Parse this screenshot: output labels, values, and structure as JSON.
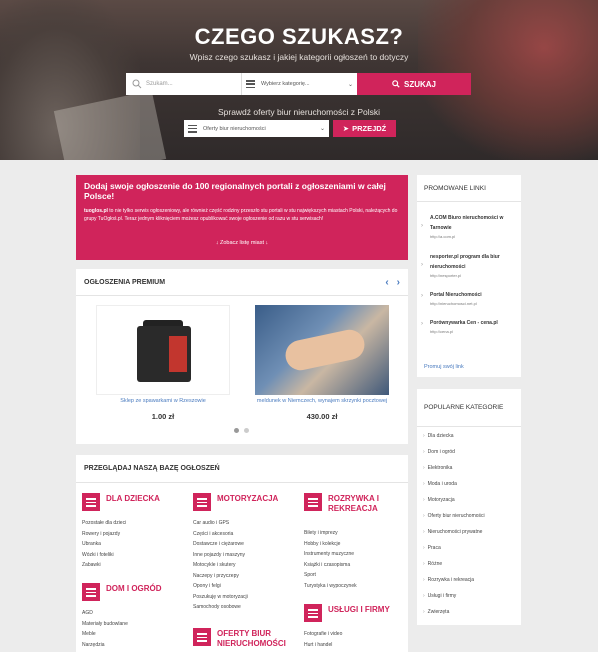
{
  "hero": {
    "title": "CZEGO SZUKASZ?",
    "subtitle": "Wpisz czego szukasz i jakiej kategorii ogłoszeń to dotyczy",
    "search_placeholder": "Szukam...",
    "category_select": "Wybierz kategorię...",
    "search_button": "SZUKAJ",
    "offices_text": "Sprawdź oferty biur nieruchomości z Polski",
    "office_select": "Oferty biur nieruchomości",
    "go_button": "PRZEJDŹ"
  },
  "banner": {
    "title": "Dodaj swoje ogłoszenie do 100 regionalnych portali z ogłoszeniami w całej Polsce!",
    "body_brand": "tuoglos.pl",
    "body": " to nie tylko serwis ogłoszeniowy, ale również część rodziny przeszło stu portali w stu największych miastach Polski, należących do grupy TuOgłoś.pl. Teraz jednym kliknięciem możesz opublikować swoje ogłoszenie od razu w stu serwisach!",
    "link": "↓ Zobacz listę miast ↓"
  },
  "premium": {
    "header": "OGŁOSZENIA PREMIUM",
    "items": [
      {
        "title": "Sklep ze spawarkami w Rzeszowie",
        "price": "1.00 zł"
      },
      {
        "title": "meldunek w Niemczech, wynajem skrzynki pocztowej",
        "price": "430.00 zł"
      }
    ]
  },
  "database": {
    "header": "PRZEGLĄDAJ NASZĄ BAZĘ OGŁOSZEŃ",
    "categories": [
      {
        "name": "DLA DZIECKA",
        "subs": [
          "Pozostałe dla dzieci",
          "Rowery i pojazdy",
          "Ubranka",
          "Wózki i foteliki",
          "Zabawki"
        ]
      },
      {
        "name": "DOM I OGRÓD",
        "subs": [
          "AGD",
          "Materiały budowlane",
          "Meble",
          "Narzędzia"
        ]
      },
      {
        "name": "MOTORYZACJA",
        "subs": [
          "Car audio i GPS",
          "Części i akcesoria",
          "Dostawcze i ciężarowe",
          "Inne pojazdy i maszyny",
          "Motocykle i skutery",
          "Naczepy i przyczepy",
          "Opony i felgi",
          "Poszukuję w motoryzacji",
          "Samochody osobowe"
        ]
      },
      {
        "name": "OFERTY BIUR NIERUCHOMOŚCI",
        "subs": []
      },
      {
        "name": "ROZRYWKA I REKREACJA",
        "subs": [
          "Bilety i imprezy",
          "Hobby i kolekcje",
          "Instrumenty muzyczne",
          "Książki i czasopisma",
          "Sport",
          "Turystyka i wypoczynek"
        ]
      },
      {
        "name": "USŁUGI I FIRMY",
        "subs": [
          "Fotografie i video",
          "Hurt i handel"
        ]
      }
    ]
  },
  "promoted": {
    "header": "PROMOWANE LINKI",
    "links": [
      {
        "title": "A.COM Biuro nieruchomości w Tarnowie",
        "url": "http://a.com.pl"
      },
      {
        "title": "nesporter.pl program dla biur nieruchomości",
        "url": "http://nesporter.pl"
      },
      {
        "title": "Portal Nieruchomości",
        "url": "http://nieruchomosci.net.pl"
      },
      {
        "title": "Porównywarka Cen - cena.pl",
        "url": "http://cena.pl"
      }
    ],
    "promote_link": "Promuj swój link"
  },
  "popular": {
    "header": "POPULARNE KATEGORIE",
    "items": [
      "Dla dziecka",
      "Dom i ogród",
      "Elektronika",
      "Moda i uroda",
      "Motoryzacja",
      "Oferty biur nieruchomości",
      "Nieruchomości prywatne",
      "Praca",
      "Różne",
      "Rozrywka i rekreacja",
      "Usługi i firmy",
      "Zwierzęta"
    ]
  },
  "colors": {
    "accent": "#d0245b",
    "link": "#4a7bbf"
  }
}
